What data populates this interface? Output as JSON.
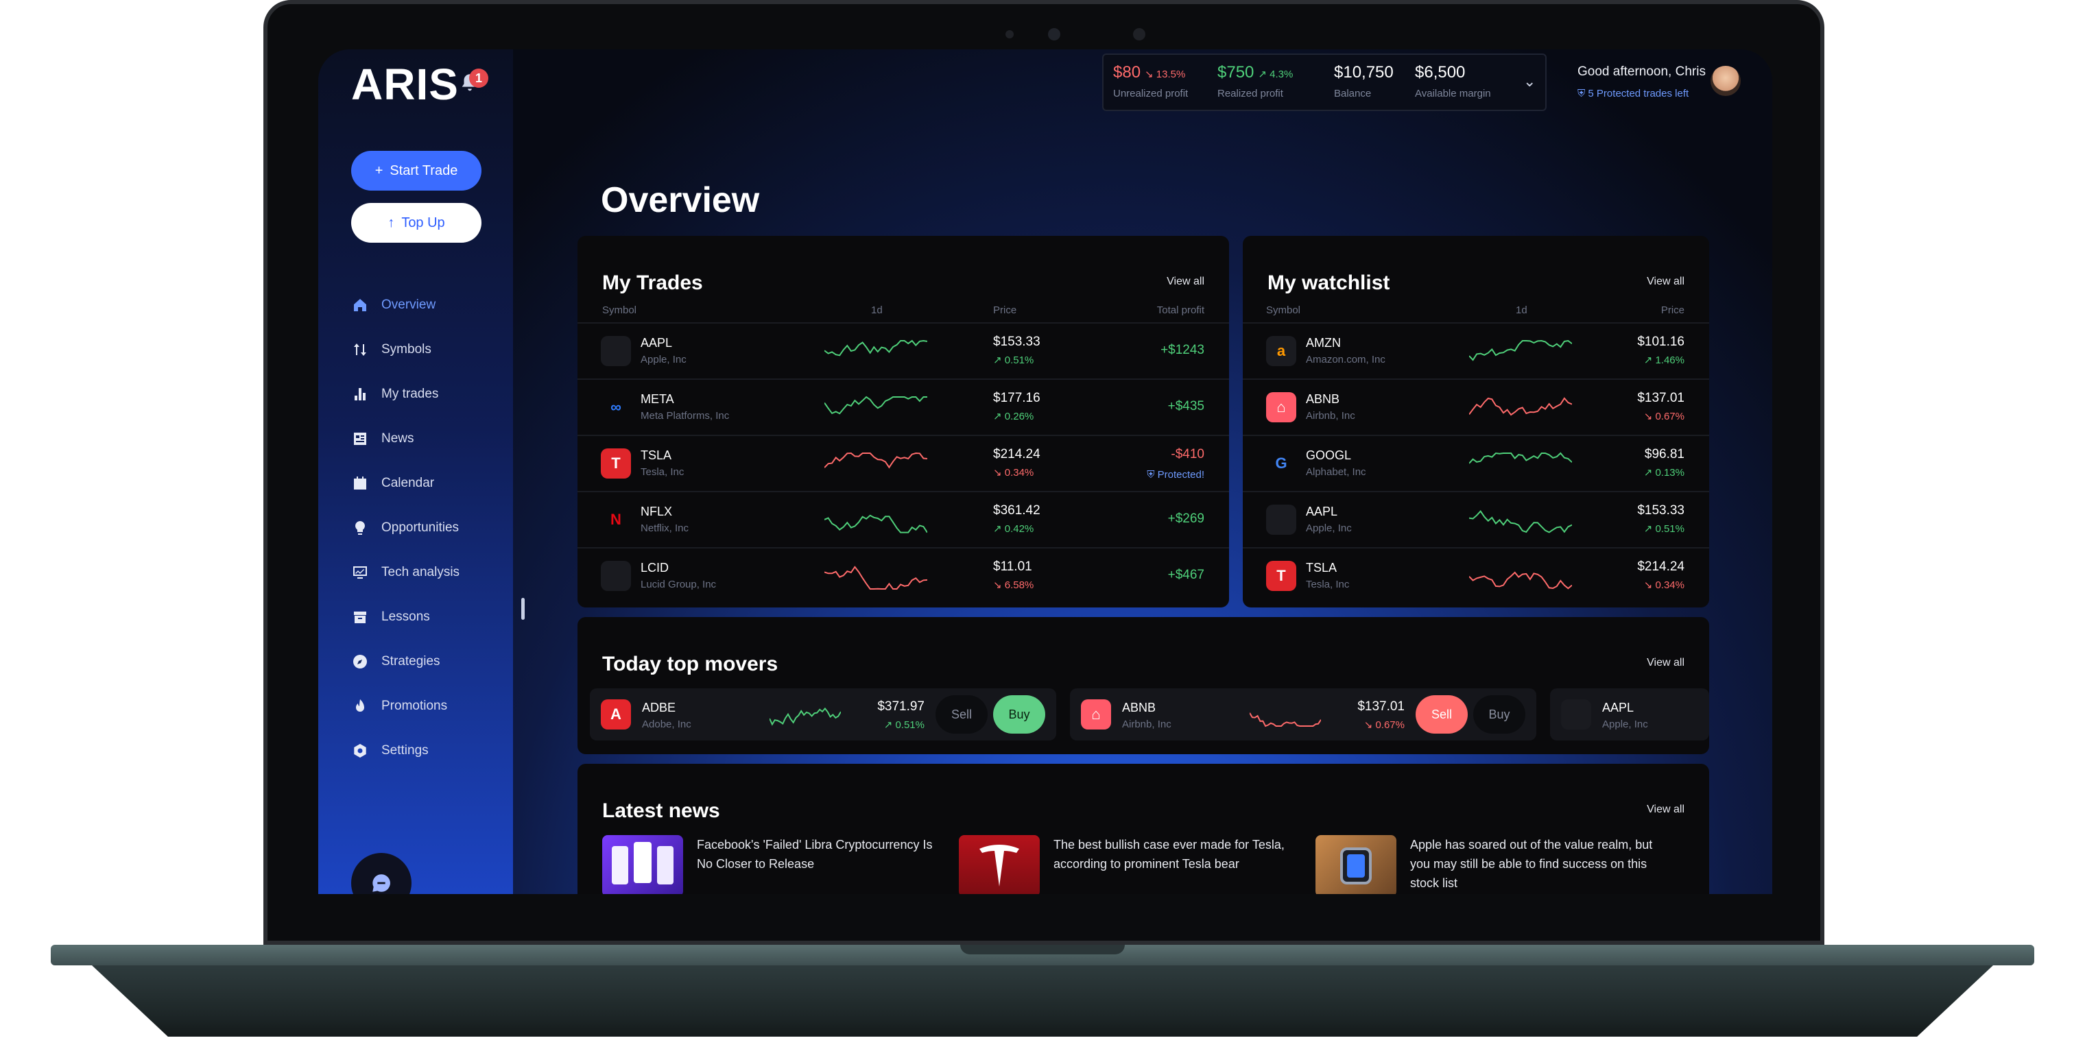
{
  "app": {
    "logo": "ARIS",
    "notification_count": "1"
  },
  "sidebar": {
    "start_trade": "Start Trade",
    "top_up": "Top Up",
    "items": [
      {
        "label": "Overview",
        "icon": "home-icon",
        "active": true
      },
      {
        "label": "Symbols",
        "icon": "arrows-updown-icon"
      },
      {
        "label": "My trades",
        "icon": "bar-chart-icon"
      },
      {
        "label": "News",
        "icon": "newspaper-icon"
      },
      {
        "label": "Calendar",
        "icon": "calendar-icon"
      },
      {
        "label": "Opportunities",
        "icon": "lightbulb-icon"
      },
      {
        "label": "Tech analysis",
        "icon": "monitor-chart-icon"
      },
      {
        "label": "Lessons",
        "icon": "archive-icon"
      },
      {
        "label": "Strategies",
        "icon": "compass-icon"
      },
      {
        "label": "Promotions",
        "icon": "fire-icon"
      },
      {
        "label": "Settings",
        "icon": "gear-icon"
      }
    ]
  },
  "header": {
    "stats": [
      {
        "value": "$80",
        "change": "↘ 13.5%",
        "label": "Unrealized profit",
        "tone": "red"
      },
      {
        "value": "$750",
        "change": "↗ 4.3%",
        "label": "Realized profit",
        "tone": "green"
      },
      {
        "value": "$10,750",
        "change": "",
        "label": "Balance",
        "tone": "neutral"
      },
      {
        "value": "$6,500",
        "change": "",
        "label": "Available margin",
        "tone": "neutral"
      }
    ],
    "greeting": "Good afternoon, Chris",
    "protected_trades": "5 Protected trades left"
  },
  "page_title": "Overview",
  "my_trades": {
    "title": "My Trades",
    "view_all": "View all",
    "columns": [
      "Symbol",
      "1d",
      "Price",
      "Total profit"
    ],
    "rows": [
      {
        "symbol": "AAPL",
        "name": "Apple, Inc",
        "price": "$153.33",
        "change": "↗ 0.51%",
        "up": true,
        "profit": "+$1243",
        "protected": ""
      },
      {
        "symbol": "META",
        "name": "Meta Platforms, Inc",
        "price": "$177.16",
        "change": "↗ 0.26%",
        "up": true,
        "profit": "+$435",
        "protected": ""
      },
      {
        "symbol": "TSLA",
        "name": "Tesla, Inc",
        "price": "$214.24",
        "change": "↘ 0.34%",
        "up": false,
        "profit": "-$410",
        "protected": "Protected!"
      },
      {
        "symbol": "NFLX",
        "name": "Netflix, Inc",
        "price": "$361.42",
        "change": "↗ 0.42%",
        "up": true,
        "profit": "+$269",
        "protected": ""
      },
      {
        "symbol": "LCID",
        "name": "Lucid Group, Inc",
        "price": "$11.01",
        "change": "↘ 6.58%",
        "up": false,
        "profit": "+$467",
        "protected": ""
      }
    ]
  },
  "watchlist": {
    "title": "My watchlist",
    "view_all": "View all",
    "columns": [
      "Symbol",
      "1d",
      "Price"
    ],
    "rows": [
      {
        "symbol": "AMZN",
        "name": "Amazon.com, Inc",
        "price": "$101.16",
        "change": "↗ 1.46%",
        "up": true
      },
      {
        "symbol": "ABNB",
        "name": "Airbnb, Inc",
        "price": "$137.01",
        "change": "↘ 0.67%",
        "up": false
      },
      {
        "symbol": "GOOGL",
        "name": "Alphabet, Inc",
        "price": "$96.81",
        "change": "↗ 0.13%",
        "up": true
      },
      {
        "symbol": "AAPL",
        "name": "Apple, Inc",
        "price": "$153.33",
        "change": "↗ 0.51%",
        "up": true
      },
      {
        "symbol": "TSLA",
        "name": "Tesla, Inc",
        "price": "$214.24",
        "change": "↘ 0.34%",
        "up": false
      }
    ]
  },
  "top_movers": {
    "title": "Today top movers",
    "view_all": "View all",
    "sell_label": "Sell",
    "buy_label": "Buy",
    "items": [
      {
        "symbol": "ADBE",
        "name": "Adobe, Inc",
        "price": "$371.97",
        "change": "↗ 0.51%",
        "up": true
      },
      {
        "symbol": "ABNB",
        "name": "Airbnb, Inc",
        "price": "$137.01",
        "change": "↘ 0.67%",
        "up": false
      },
      {
        "symbol": "AAPL",
        "name": "Apple, Inc",
        "price": "",
        "change": "",
        "up": true
      }
    ]
  },
  "latest_news": {
    "title": "Latest news",
    "view_all": "View all",
    "items": [
      {
        "headline": "Facebook's 'Failed' Libra Cryptocurrency Is No Closer to Release"
      },
      {
        "headline": "The best bullish case ever made for Tesla, according to prominent Tesla bear"
      },
      {
        "headline": "Apple has soared out of the value realm, but you may still be able to find success on this stock list"
      }
    ]
  },
  "colors": {
    "accent": "#3b6cff",
    "up": "#4fd07a",
    "down": "#ff6b6b",
    "card": "#0a0a0c"
  }
}
